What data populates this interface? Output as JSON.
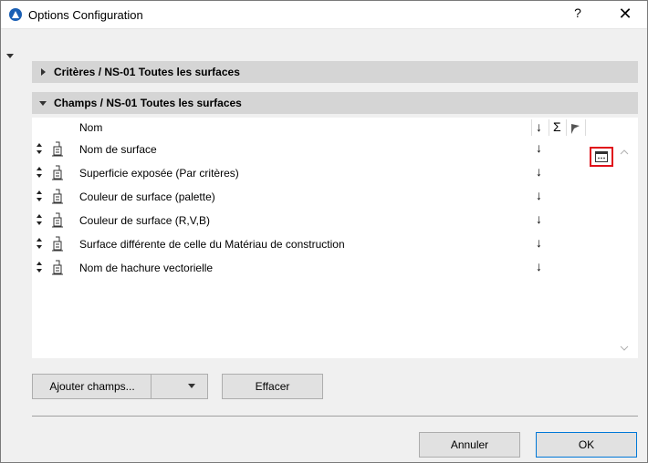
{
  "window": {
    "title": "Options Configuration",
    "help_label": "?",
    "close_label": "✕"
  },
  "criteria_section": {
    "label": "Critères / NS-01 Toutes les surfaces"
  },
  "fields_section": {
    "label": "Champs / NS-01 Toutes les surfaces",
    "columns": {
      "name": "Nom",
      "sort_icon": "↓",
      "sum_icon": "Σ",
      "flag_icon": "flag-icon"
    },
    "rows": [
      {
        "name": "Nom de surface",
        "sort": "↓"
      },
      {
        "name": "Superficie exposée (Par critères)",
        "sort": "↓"
      },
      {
        "name": "Couleur de surface (palette)",
        "sort": "↓"
      },
      {
        "name": "Couleur de surface (R,V,B)",
        "sort": "↓"
      },
      {
        "name": "Surface différente de celle du Matériau de construction",
        "sort": "↓"
      },
      {
        "name": "Nom de hachure vectorielle",
        "sort": "↓"
      }
    ]
  },
  "buttons": {
    "add_fields": "Ajouter champs...",
    "clear": "Effacer",
    "cancel": "Annuler",
    "ok": "OK"
  },
  "colors": {
    "highlight_border": "#e0101a",
    "header_bg": "#d5d5d5",
    "ok_border": "#0078d7"
  }
}
